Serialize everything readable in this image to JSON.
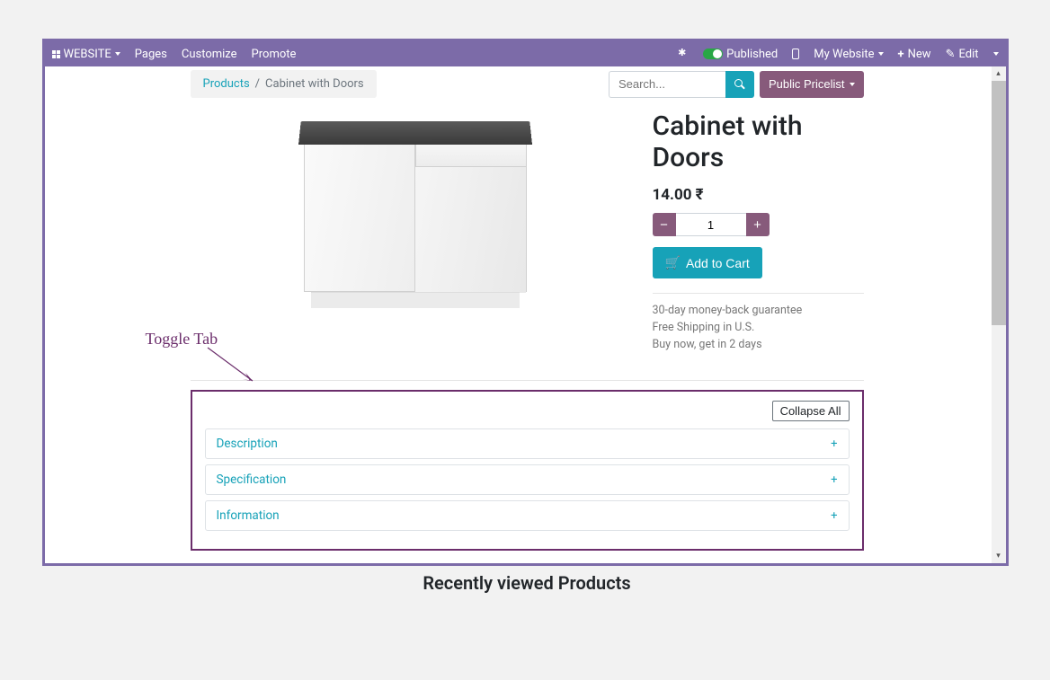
{
  "topbar": {
    "website_label": "WEBSITE",
    "pages": "Pages",
    "customize": "Customize",
    "promote": "Promote",
    "published": "Published",
    "my_website": "My Website",
    "new": "New",
    "edit": "Edit"
  },
  "breadcrumb": {
    "products": "Products",
    "sep": "/",
    "current": "Cabinet with Doors"
  },
  "search": {
    "placeholder": "Search..."
  },
  "pricelist": {
    "label": "Public Pricelist"
  },
  "product": {
    "title": "Cabinet with Doors",
    "price": "14.00 ₹",
    "qty": "1",
    "add_to_cart": "Add to Cart",
    "guarantee": "30-day money-back guarantee",
    "shipping": "Free Shipping in U.S.",
    "delivery": "Buy now, get in 2 days"
  },
  "tabs": {
    "collapse_all": "Collapse All",
    "items": [
      {
        "title": "Description"
      },
      {
        "title": "Specification"
      },
      {
        "title": "Information"
      }
    ]
  },
  "recently": {
    "title": "Recently viewed Products"
  },
  "annotation": {
    "label": "Toggle  Tab"
  }
}
